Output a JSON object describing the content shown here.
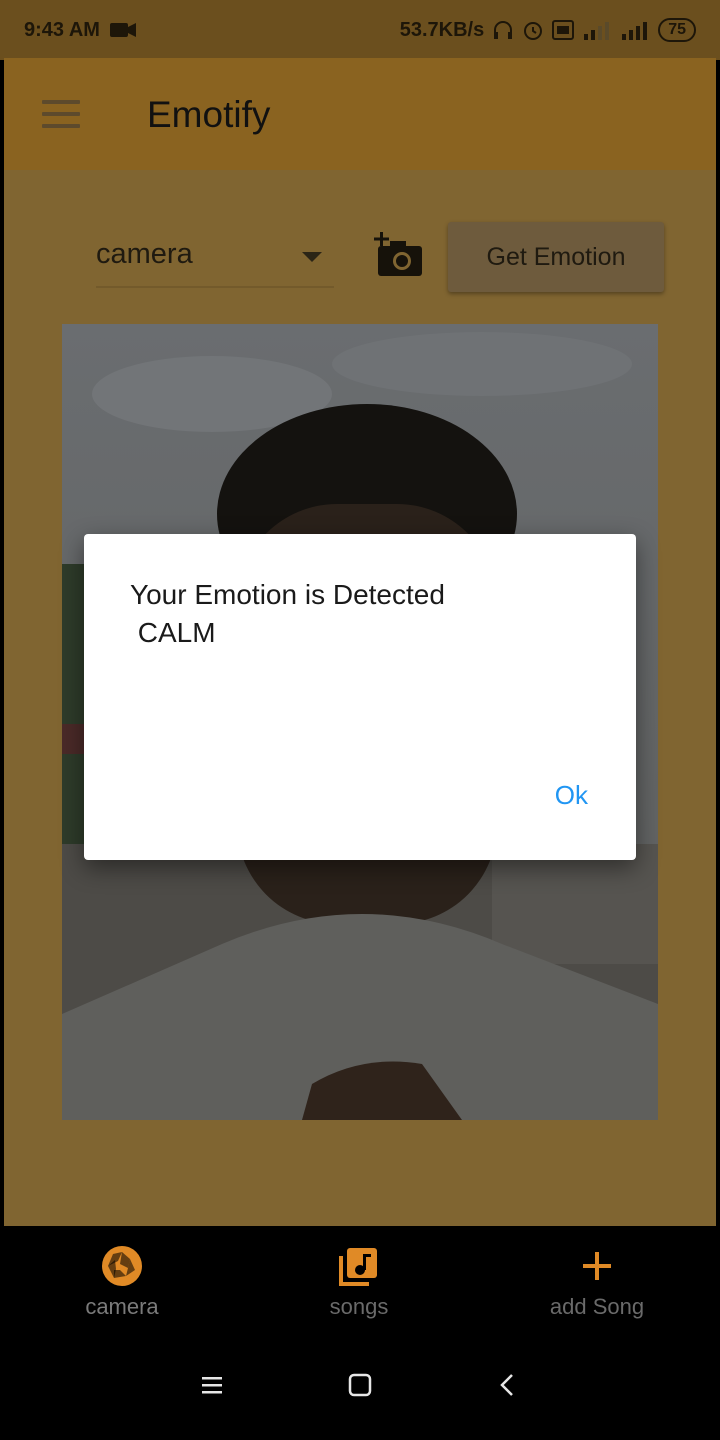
{
  "status_bar": {
    "time": "9:43 AM",
    "speed": "53.7KB/s",
    "battery": "75"
  },
  "app_bar": {
    "title": "Emotify"
  },
  "controls": {
    "source_select_value": "camera",
    "get_emotion_label": "Get Emotion"
  },
  "dialog": {
    "line1": "Your Emotion is Detected",
    "line2": " CALM",
    "ok_label": "Ok"
  },
  "bottom_nav": {
    "items": [
      {
        "label": "camera",
        "icon": "camera-shutter-icon"
      },
      {
        "label": "songs",
        "icon": "music-library-icon"
      },
      {
        "label": "add Song",
        "icon": "plus-icon"
      }
    ]
  },
  "colors": {
    "app_bar": "#8a6320",
    "content_bg": "#806531",
    "accent": "#e08a26",
    "ok_button": "#2196f3"
  }
}
